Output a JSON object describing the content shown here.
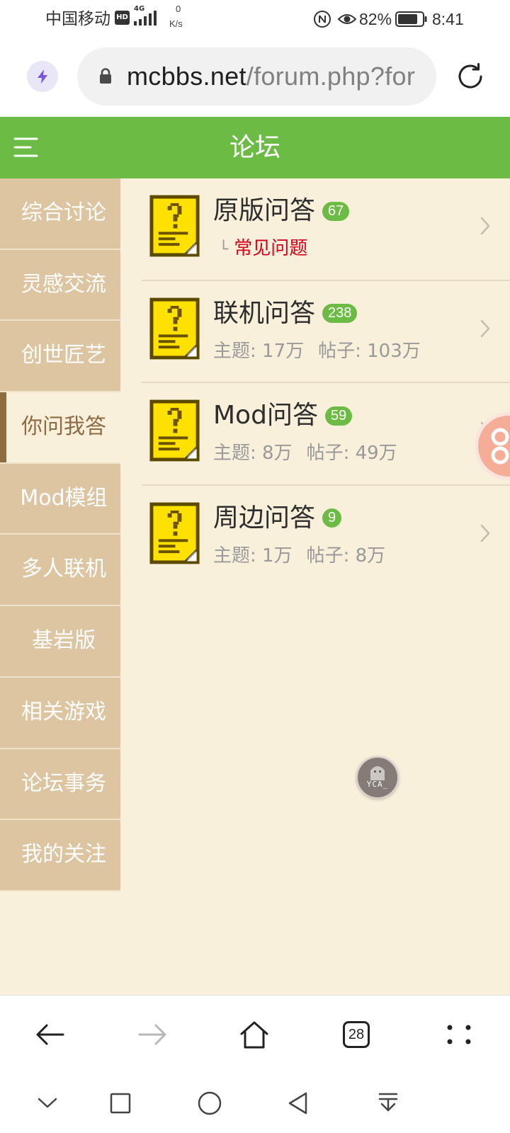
{
  "status_bar": {
    "carrier": "中国移动",
    "hd_label": "HD",
    "network_type": "4G",
    "net_speed_value": "0",
    "net_speed_unit": "K/s",
    "battery_percent": "82%",
    "time": "8:41",
    "icons": [
      "signal-strength-icon",
      "nfc-icon",
      "eye-comfort-icon",
      "battery-icon"
    ]
  },
  "address_bar": {
    "site_icon": "lightning-icon",
    "lock_icon": "lock-icon",
    "url_domain": "mcbbs.net",
    "url_path": "/forum.php?for",
    "reload_icon": "reload-icon"
  },
  "header": {
    "menu_icon": "menu-icon",
    "title": "论坛"
  },
  "sidebar": {
    "items": [
      {
        "label": "综合讨论"
      },
      {
        "label": "灵感交流"
      },
      {
        "label": "创世匠艺"
      },
      {
        "label": "你问我答",
        "selected": true
      },
      {
        "label": "Mod模组"
      },
      {
        "label": "多人联机"
      },
      {
        "label": "基岩版"
      },
      {
        "label": "相关游戏"
      },
      {
        "label": "论坛事务"
      },
      {
        "label": "我的关注"
      }
    ]
  },
  "forums": [
    {
      "name": "原版问答",
      "new_count": "67",
      "subforum_marker": "└",
      "subforum": "常见问题",
      "icon": "question-note-icon"
    },
    {
      "name": "联机问答",
      "new_count": "238",
      "topics": "主题: 17万",
      "posts": "帖子: 103万",
      "icon": "question-note-icon"
    },
    {
      "name": "Mod问答",
      "new_count": "59",
      "topics": "主题: 8万",
      "posts": "帖子: 49万",
      "icon": "question-note-icon"
    },
    {
      "name": "周边问答",
      "new_count": "9",
      "topics": "主题: 1万",
      "posts": "帖子: 8万",
      "icon": "question-note-icon"
    }
  ],
  "floating_avatar": {
    "text": "YCA_"
  },
  "browser_nav": {
    "back_icon": "back-arrow-icon",
    "forward_icon": "forward-arrow-icon",
    "home_icon": "home-icon",
    "tab_count": "28",
    "menu_icon": "more-dots-icon"
  },
  "system_nav": {
    "icons": [
      "collapse-chevron-icon",
      "recents-square-icon",
      "home-circle-icon",
      "back-triangle-icon",
      "notification-pull-icon"
    ]
  },
  "colors": {
    "header_green": "#6cbb45",
    "sidebar_tan": "#dcc5a0",
    "content_cream": "#f9f0dc",
    "selected_brown": "#8d6b43",
    "badge_green": "#6cbb45",
    "subforum_red": "#d9001b",
    "stats_gray": "#999999"
  }
}
